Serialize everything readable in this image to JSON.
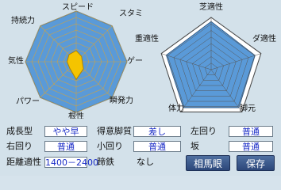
{
  "left_radar": {
    "axes": [
      "スピード",
      "スタミナ",
      "ゲート",
      "瞬発力",
      "根性",
      "パワー",
      "気性",
      "持続力"
    ],
    "values": [
      0.22,
      0.15,
      0.12,
      0.2,
      0.35,
      0.18,
      0.18,
      0.2
    ]
  },
  "right_radar": {
    "axes": [
      "芝適性",
      "ダ適性",
      "脚元",
      "体力",
      "重適性"
    ],
    "values": [
      0.92,
      0.88,
      0.9,
      0.9,
      0.9
    ],
    "rings": 8
  },
  "fields": {
    "growth_label": "成長型",
    "growth_value": "やや早",
    "strategy_label": "得意脚質",
    "strategy_value": "差し",
    "left_turn_label": "左回り",
    "left_turn_value": "普通",
    "right_turn_label": "右回り",
    "right_turn_value": "普通",
    "small_turn_label": "小回り",
    "small_turn_value": "普通",
    "slope_label": "坂",
    "slope_value": "普通",
    "distance_label": "距離適性",
    "distance_value": "1400－2400",
    "hoof_label": "蹄鉄",
    "hoof_value": "なし"
  },
  "buttons": {
    "soma_label": "相馬眼",
    "save_label": "保存"
  },
  "colors": {
    "left_fill": "#5a9ad8",
    "right_fill": "#5a9ad8",
    "value_fill": "#f5c400",
    "value_stroke": "#b08400",
    "grid_line": "#c9a24a",
    "value_text": "#1a2cc7"
  }
}
